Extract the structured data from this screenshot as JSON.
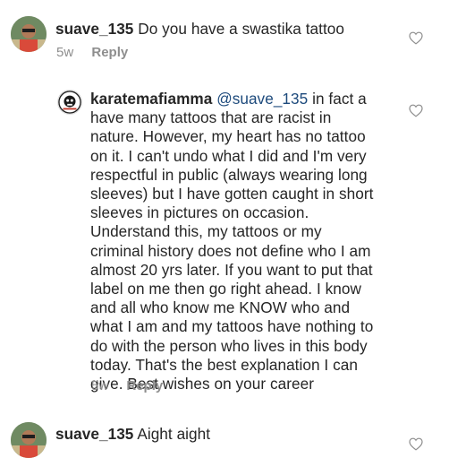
{
  "comments": [
    {
      "username": "suave_135",
      "text": "Do you have a swastika tattoo",
      "time": "5w",
      "reply_label": "Reply",
      "avatar_icon": "profile-avatar-suave"
    },
    {
      "username": "karatemafiamma",
      "mention": "@suave_135",
      "first_line_rest": " in fact a",
      "lines": [
        "have many tattoos that are racist in",
        "nature. However, my heart has no tattoo",
        "on it. I can't undo what I did and I'm very",
        "respectful in public (always wearing long",
        "sleeves) but I have gotten caught in short",
        "sleeves in pictures on occasion.",
        "Understand this, my tattoos or my",
        "criminal history does not define who I am",
        "almost 20 yrs later. If you want to put that",
        "label on me then go right ahead. I know",
        "and all who know me KNOW who and",
        "what I am and my tattoos have nothing to",
        "do with the person who lives in this body",
        "today. That's the best explanation I can",
        "give. Best wishes on your career"
      ],
      "time": "5w",
      "reply_label": "Reply",
      "avatar_icon": "profile-avatar-karatemafiamma"
    },
    {
      "username": "suave_135",
      "text": "Aight aight",
      "avatar_icon": "profile-avatar-suave"
    }
  ],
  "colors": {
    "text": "#262626",
    "meta": "#8e8e8e",
    "mention": "#1d4a7c",
    "heart_stroke": "#8e8e8e"
  },
  "like_icon": "heart-outline-icon"
}
